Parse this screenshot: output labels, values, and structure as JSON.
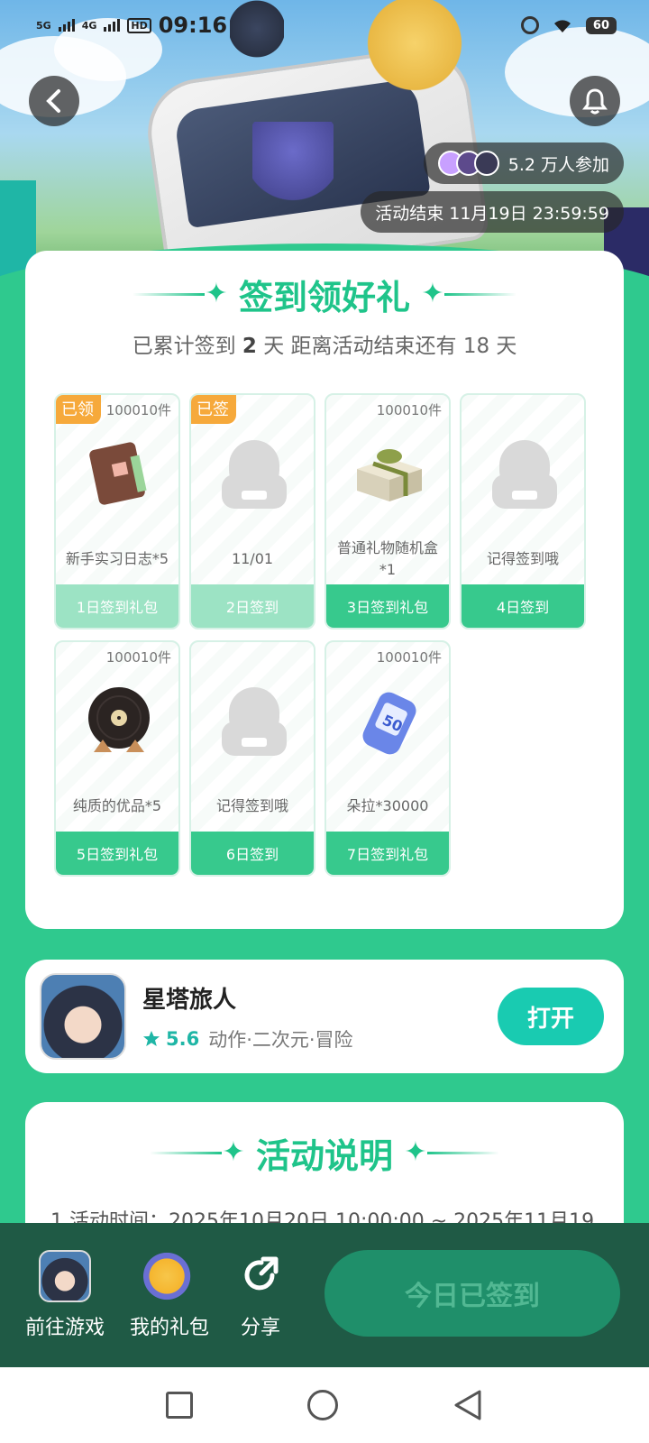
{
  "status_bar": {
    "time": "09:16",
    "sim1_type": "5G",
    "sim2_type": "4G",
    "hd_label": "HD",
    "battery": "60"
  },
  "banner": {
    "participants": "5.2 万人参加",
    "end_time": "活动结束 11月19日 23:59:59"
  },
  "checkin": {
    "title": "签到领好礼",
    "summary_prefix": "已累计签到",
    "summary_days": "2",
    "summary_suffix": "天  距离活动结束还有 18 天",
    "days": [
      {
        "badge": "已领",
        "qty": "100010件",
        "name": "新手实习日志*5",
        "footer": "1日签到礼包",
        "icon": "journal-icon",
        "state": "claimed"
      },
      {
        "badge": "已签",
        "qty": "",
        "name": "11/01",
        "footer": "2日签到",
        "icon": "placeholder-icon",
        "state": "claimed"
      },
      {
        "badge": "",
        "qty": "100010件",
        "name": "普通礼物随机盒*1",
        "footer": "3日签到礼包",
        "icon": "gift-box-icon",
        "state": "pending"
      },
      {
        "badge": "",
        "qty": "",
        "name": "记得签到哦",
        "footer": "4日签到",
        "icon": "placeholder-icon",
        "state": "pending"
      },
      {
        "badge": "",
        "qty": "100010件",
        "name": "纯质的优品*5",
        "footer": "5日签到礼包",
        "icon": "vinyl-record-icon",
        "state": "pending"
      },
      {
        "badge": "",
        "qty": "",
        "name": "记得签到哦",
        "footer": "6日签到",
        "icon": "placeholder-icon",
        "state": "pending"
      },
      {
        "badge": "",
        "qty": "100010件",
        "name": "朵拉*30000",
        "footer": "7日签到礼包",
        "icon": "coin-roll-icon",
        "state": "pending"
      }
    ]
  },
  "game": {
    "name": "星塔旅人",
    "rating": "5.6",
    "tags": "动作·二次元·冒险",
    "open_label": "打开"
  },
  "rules": {
    "title": "活动说明",
    "line1": "1.活动时间：2025年10月20日 10:00:00 ~ 2025年11月19"
  },
  "action_bar": {
    "goto_game": "前往游戏",
    "my_gifts": "我的礼包",
    "share": "分享",
    "checkin_button": "今日已签到"
  },
  "colors": {
    "accent": "#1fc48a",
    "badge": "#f6a93b",
    "bar": "#1f5a45"
  }
}
